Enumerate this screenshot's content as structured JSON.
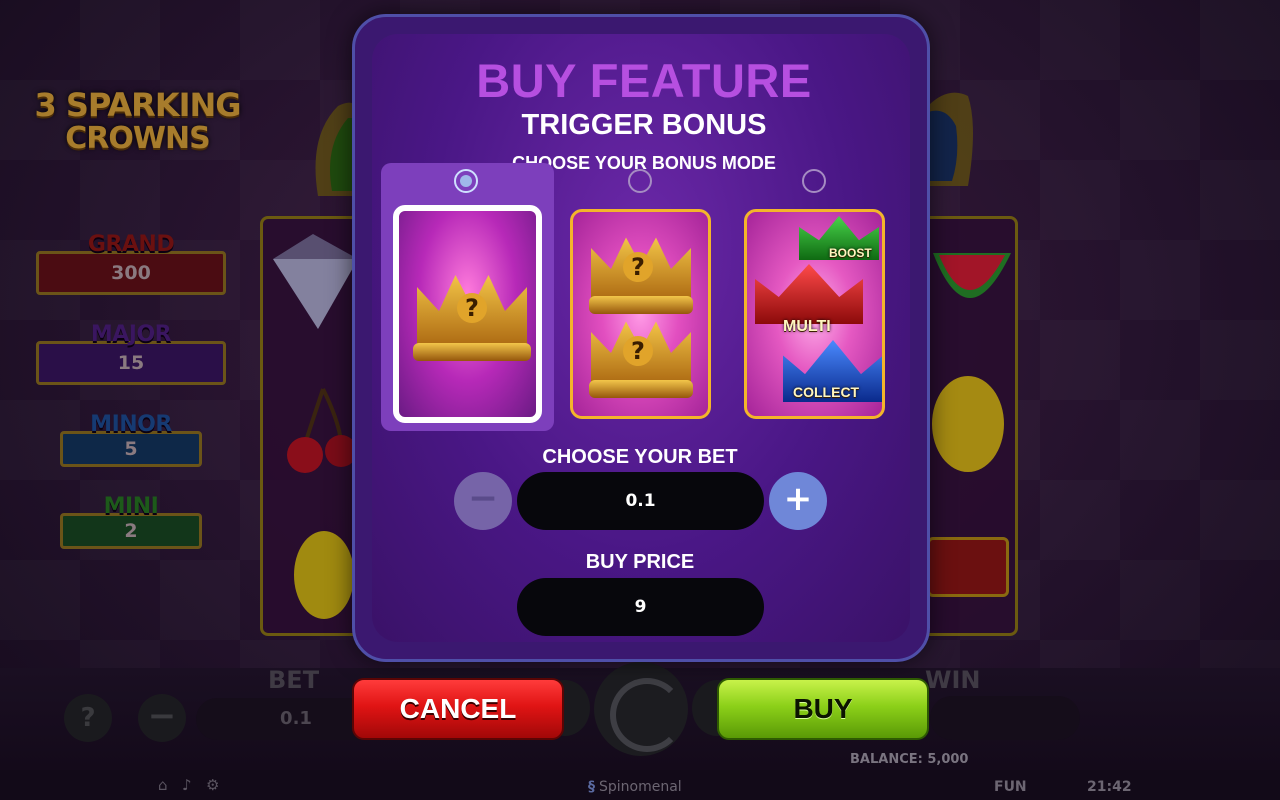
{
  "game": {
    "logo_line1": "3 SPARKING",
    "logo_line2": "CROWNS",
    "jackpots": [
      {
        "name": "GRAND",
        "value": "300"
      },
      {
        "name": "MAJOR",
        "value": "15"
      },
      {
        "name": "MINOR",
        "value": "5"
      },
      {
        "name": "MINI",
        "value": "2"
      }
    ],
    "bottom_bar": {
      "help_label": "?",
      "bet_label": "BET",
      "bet_value": "0.1",
      "win_label": "WIN",
      "minus_label": "−"
    },
    "balance_text": "BALANCE: 5,000",
    "status": {
      "brand": "Spinomenal",
      "mode": "FUN",
      "time": "21:42"
    }
  },
  "modal": {
    "title": "BUY FEATURE",
    "subtitle": "TRIGGER BONUS",
    "mode_label": "CHOOSE YOUR BONUS MODE",
    "options": [
      {
        "selected": true
      },
      {
        "selected": false
      },
      {
        "selected": false
      }
    ],
    "card3_labels": [
      "BOOST",
      "MULTI",
      "COLLECT"
    ],
    "bet_label": "CHOOSE YOUR BET",
    "bet_value": "0.1",
    "minus_label": "−",
    "plus_label": "+",
    "price_label": "BUY PRICE",
    "price_value": "9",
    "cancel_label": "CANCEL",
    "buy_label": "BUY"
  },
  "colors": {
    "title": "#b64fe0",
    "buy": "#8cd019",
    "cancel": "#e01414",
    "panel": "#4a1786"
  }
}
